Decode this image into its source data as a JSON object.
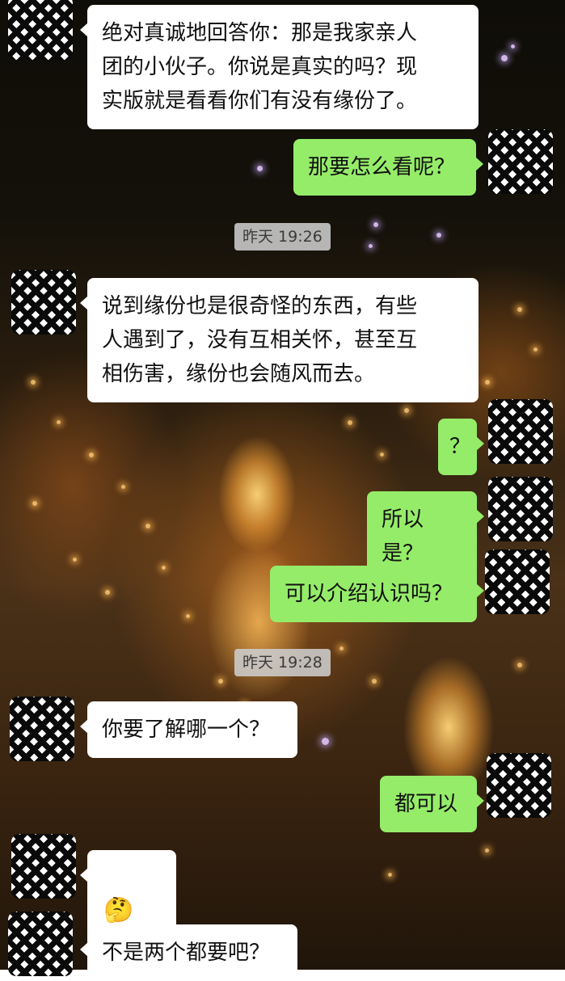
{
  "messages": [
    {
      "side": "left",
      "text": "绝对真诚地回答你：那是我家亲人\n团的小伙子。你说是真实的吗？现\n实版就是看看你们有没有缘份了。"
    },
    {
      "side": "right",
      "text": "那要怎么看呢？"
    },
    {
      "side": "left",
      "text": "说到缘份也是很奇怪的东西，有些\n人遇到了，没有互相关怀，甚至互\n相伤害，缘份也会随风而去。"
    },
    {
      "side": "right",
      "text": "？"
    },
    {
      "side": "right",
      "text": "所以是？"
    },
    {
      "side": "right",
      "text": "可以介绍认识吗？"
    },
    {
      "side": "left",
      "text": "你要了解哪一个？"
    },
    {
      "side": "right",
      "text": "都可以"
    },
    {
      "side": "left",
      "text": "🤔🤔",
      "emoji_names": [
        "thinking-face-emoji",
        "thinking-face-emoji"
      ]
    },
    {
      "side": "left",
      "text": "不是两个都要吧？"
    }
  ],
  "timestamps": [
    "昨天 19:26",
    "昨天 19:28"
  ],
  "colors": {
    "incoming_bubble": "#ffffff",
    "outgoing_bubble": "#95ec69",
    "timestamp_bg": "#cdcdcd",
    "text": "#111111"
  },
  "icons": {
    "avatar_pattern": "houndstooth-avatar-icon"
  }
}
